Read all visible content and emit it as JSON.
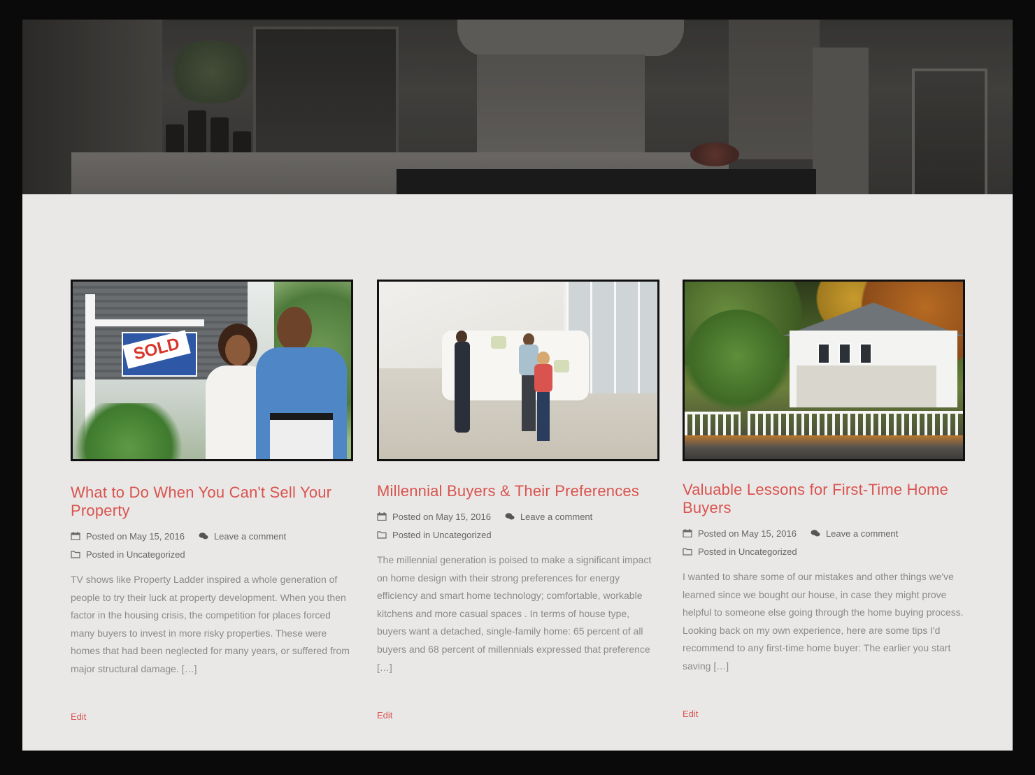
{
  "posts": [
    {
      "image_alt": "Couple in front of sold sign",
      "title": "What to Do When You Can't Sell Your Property",
      "posted": "Posted on May 15, 2016",
      "comment": "Leave a comment",
      "category": "Posted in Uncategorized",
      "excerpt": "TV shows like Property Ladder inspired a whole generation of people to try their luck at property development. When you then factor in the housing crisis, the competition for places forced many buyers to invest in more risky properties. These were homes that had been neglected for many years, or suffered from major structural damage. […]",
      "edit": "Edit"
    },
    {
      "image_alt": "Buyers shaking hands in living room",
      "title": "Millennial Buyers & Their Preferences",
      "posted": "Posted on May 15, 2016",
      "comment": "Leave a comment",
      "category": "Posted in Uncategorized",
      "excerpt": "The millennial generation is poised to make a significant impact on home design with their strong preferences for energy efficiency and smart home technology; comfortable, workable kitchens and more casual spaces . In terms of house type, buyers want a detached, single-family home: 65 percent of all buyers and 68 percent of millennials expressed that preference […]",
      "edit": "Edit"
    },
    {
      "image_alt": "White house with picket fence",
      "title": "Valuable Lessons for First-Time Home Buyers",
      "posted": "Posted on May 15, 2016",
      "comment": "Leave a comment",
      "category": "Posted in Uncategorized",
      "excerpt": "I wanted to share some of our mistakes and other things we've learned since we bought our house, in case they might prove helpful to someone else going through the home buying process. Looking back on my own experience, here are some tips I'd recommend to any first-time home buyer: The earlier you start saving […]",
      "edit": "Edit"
    }
  ],
  "colors": {
    "accent": "#d9534f",
    "meta": "#666666",
    "excerpt": "#8a8a8a",
    "background": "#e9e8e6"
  },
  "icons": {
    "date": "calendar-icon",
    "comment": "comment-bubbles-icon",
    "category": "folder-icon"
  }
}
